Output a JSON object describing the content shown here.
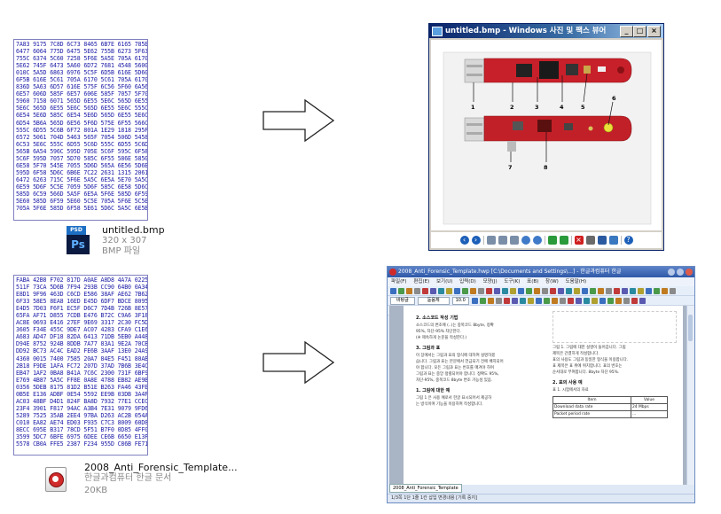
{
  "hex_dump_top": [
    "7A83 9175 7C8D 6C73 8465 6B7E 6165 785E",
    "6477 6064 775D 6475 5E62 755B 6273 5F63",
    "755C 6374 5C60 7258 5F6E 5A5E 705A 6170",
    "5E62 745F 6473 5A60 6D72 7681 4548 5600",
    "010C 5A5D 6863 6976 5C5F 6D5B 616E 5D60",
    "6F5B 616E 5C61 705A 6170 5C61 705A 6170",
    "836D 5A63 6D57 616E 575F 6C56 5F60 6A56",
    "6E57 606D 585F 6E57 606E 585F 7057 5F70",
    "5960 7158 6071 565D 6E55 5E6C 565D 6E55",
    "5E6C 565D 6E55 5E6C 565D 6E55 5E6C 555C",
    "6E54 5E6D 585C 6E54 5E6D 565D 6E55 5E6C",
    "6D54 5B6A 565D 6E56 5F6D 575E 6F55 566C",
    "555C 6D55 5C6B 6F72 801A 1E29 1818 295F",
    "6572 5061 704D 5463 565F 7054 506D 5458",
    "6C53 5E6C 555C 6D55 5C6D 555C 6D55 5C6D",
    "565B 6A54 596C 595D 705E 5C6F 595C 6F58",
    "5C6F 595D 7057 5D70 585C 6F55 586E 5850",
    "6E58 5F70 545E 7055 5D6D 565A 6E56 5D6E",
    "595D 6F58 5D6C 6B6E 7C22 2631 1315 2061",
    "6472 6263 715C 5F6E 5A5C 6E5A 5E70 5A5C",
    "6E59 5D6F 5C5E 7059 5D6F 585C 6E58 5D6C",
    "585D 6C59 566D 5A5F 6E5A 5F6E 585D 6F59",
    "5E60 585D 6F59 5E60 5C5E 705A 5F6E 5C5E",
    "705A 5F6E 585D 6F58 5E61 5D6C 5A5C 6E5B"
  ],
  "hex_dump_bottom": [
    "FABA 42B8 F702 817D A0AE A8D8 4A7A 0225",
    "511F 73CA 5D6B 7F94 293B CC90 64B0 0A34",
    "E8D1 9F96 463D C6CD E586 38AF AE62 7B62",
    "6F33 58E5 8EA8 16ED E45D 6DF7 BDCE 8095",
    "E4D5 7D03 F6F1 EC5F D6C7 7D4B 726B 8E57",
    "65FA AF71 D855 7CDB E476 B72C C9A6 3F18",
    "AC8E 0693 E416 27EF 9E69 3317 2C30 FC5D",
    "3605 F34E 455C 9DE7 AC07 4283 CFA9 C1E6",
    "A683 AD47 DF18 82DA 6413 71DB 5EB0 A448",
    "D94E 8752 924B 8DDB 7A77 83A1 9E2A 70CB",
    "DD92 BC73 AC4C EAD2 FE6B 3AAF 13E0 24A9",
    "4360 0015 7400 7585 20A7 84E5 F451 80AB",
    "2B18 F9DE 1AFA FC72 207D 37AD 7B6B 3E4C",
    "EB47 1AF2 0BA8 B41A 7C6C 2300 731F 6BF9",
    "E769 4B87 5A5C FF8E 0A8E 4788 EB82 AE9B",
    "0356 5DEB 8175 81D2 B51E B263 FA46 43FE",
    "0B5E E136 ADBF 0E54 5592 EE9B 03DB 3A4F",
    "AC03 48BF D4D1 824F BA8D 7932 77E1 CCEC",
    "23F4 3901 F817 94AC A3B4 7E31 9079 9FD6",
    "5289 7525 35AB 2EE4 97BA D263 AC2B 054A",
    "C010 EA82 AE74 ED03 F935 C7C3 8009 60D8",
    "8ECC 695E B317 78CD 5F51 B7F0 0D85 4FF0",
    "3599 5DC7 6BFE 6975 6DEE CE6B 6650 E13F",
    "5578 CB0A FFE5 2387 F234 955D C86B FE71"
  ],
  "file_top": {
    "name": "untitled.bmp",
    "meta1": "320 x 307",
    "meta2": "BMP 파일",
    "icon_label": "PSD",
    "icon_letter": "Ps"
  },
  "file_bottom": {
    "name_line1": "2008_Anti_Forensic_Template...",
    "name_line2": "한글과컴퓨터 한글 문서",
    "size": "20KB"
  },
  "viewer": {
    "title": "untitled.bmp - Windows 사진 및 팩스 뷰어",
    "min_label": "_",
    "max_label": "□",
    "close_label": "×",
    "callouts": [
      "1",
      "2",
      "3",
      "4",
      "5",
      "6",
      "7",
      "8"
    ]
  },
  "hwp": {
    "title": "2008_Anti_Forensic_Template.hwp [C:\\Documents and Settings\\...] - 한글과컴퓨터 한글",
    "menu": [
      "파일(F)",
      "편집(E)",
      "보기(U)",
      "입력(D)",
      "모양(J)",
      "도구(K)",
      "표(B)",
      "창(W)",
      "도움말(H)"
    ],
    "style_box": "바탕글",
    "font_box": "돋움체",
    "size_box": "10.0",
    "status": "1/3쪽  1단  1줄  1칸  삽입  변경내용 [기록 중지]",
    "tab_label": "2008_Anti_Forensic_Template",
    "left_col": [
      {
        "h": "2. 소스코드 작성 기법"
      },
      {
        "t": "소스코드의 변조에 (..)는 중복코드 8byte, 정확"
      },
      {
        "t": "95%, 차단-95% 차단한다."
      },
      {
        "t": "(※ 제속하게 논문을 작성한다.)"
      },
      {
        "h": "3. 그림과 표"
      },
      {
        "t": "이 장에서는 그림과 표의 형식에 대하여 설명하겠"
      },
      {
        "t": "습니다. 그림과 표는 본문에서 언급되기 전에 배치되어"
      },
      {
        "t": "야 합니다. 모든 그림과 표는 번호를 매겨야 하며"
      },
      {
        "t": "그림과 표는 중앙 정렬되어야 합니다. 정확도 95%,"
      },
      {
        "t": "차단-95%, 중복코드 8byte 변조 가능성 있음."
      },
      {
        "h": "1. 그림에 대한 예"
      },
      {
        "t": "그림 1 은 사용 예로서 한글 표시되어서 제공하"
      },
      {
        "t": "는 방식이며 기능을 이용하여 작성합니다."
      }
    ],
    "right_col": [
      {
        "t": "그림 1. 그림에 대한 설명이 들어갑니다. 그림"
      },
      {
        "t": "제목은 간결하게 작성합니다."
      },
      {
        "t": "표의 사용도 그림과 동일한 형식을 이용합니다."
      },
      {
        "t": "표 제목은 표 위에 위치합니다. 표의 번호는"
      },
      {
        "t": "순서대로 부여합니다. 8byte 차단 95%."
      },
      {
        "h": "2. 표의 사용 예"
      },
      {
        "t": "표 1. 시험에서의 자료"
      }
    ],
    "table": {
      "headers": [
        "Item",
        "Value"
      ],
      "rows": [
        [
          "Download data rate",
          "24 Mbps"
        ],
        [
          "Packet period rate",
          "..."
        ]
      ]
    }
  }
}
